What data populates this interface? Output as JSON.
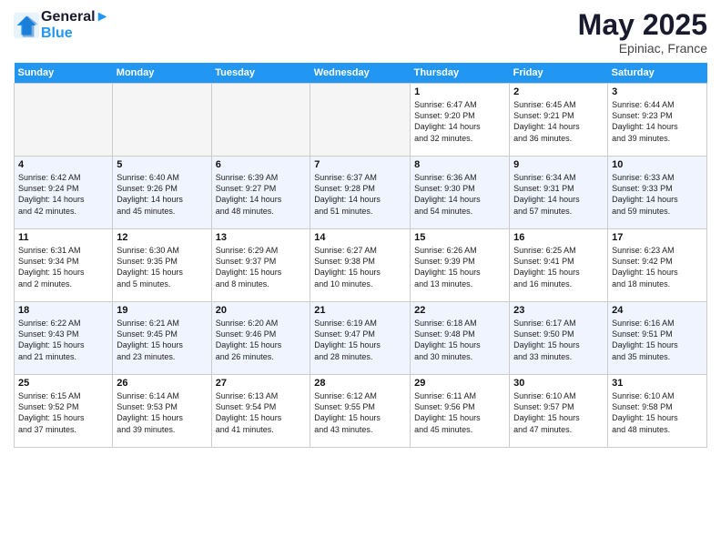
{
  "header": {
    "logo_line1": "General",
    "logo_line2": "Blue",
    "month": "May 2025",
    "location": "Epiniac, France"
  },
  "weekdays": [
    "Sunday",
    "Monday",
    "Tuesday",
    "Wednesday",
    "Thursday",
    "Friday",
    "Saturday"
  ],
  "weeks": [
    [
      {
        "day": "",
        "info": ""
      },
      {
        "day": "",
        "info": ""
      },
      {
        "day": "",
        "info": ""
      },
      {
        "day": "",
        "info": ""
      },
      {
        "day": "1",
        "info": "Sunrise: 6:47 AM\nSunset: 9:20 PM\nDaylight: 14 hours\nand 32 minutes."
      },
      {
        "day": "2",
        "info": "Sunrise: 6:45 AM\nSunset: 9:21 PM\nDaylight: 14 hours\nand 36 minutes."
      },
      {
        "day": "3",
        "info": "Sunrise: 6:44 AM\nSunset: 9:23 PM\nDaylight: 14 hours\nand 39 minutes."
      }
    ],
    [
      {
        "day": "4",
        "info": "Sunrise: 6:42 AM\nSunset: 9:24 PM\nDaylight: 14 hours\nand 42 minutes."
      },
      {
        "day": "5",
        "info": "Sunrise: 6:40 AM\nSunset: 9:26 PM\nDaylight: 14 hours\nand 45 minutes."
      },
      {
        "day": "6",
        "info": "Sunrise: 6:39 AM\nSunset: 9:27 PM\nDaylight: 14 hours\nand 48 minutes."
      },
      {
        "day": "7",
        "info": "Sunrise: 6:37 AM\nSunset: 9:28 PM\nDaylight: 14 hours\nand 51 minutes."
      },
      {
        "day": "8",
        "info": "Sunrise: 6:36 AM\nSunset: 9:30 PM\nDaylight: 14 hours\nand 54 minutes."
      },
      {
        "day": "9",
        "info": "Sunrise: 6:34 AM\nSunset: 9:31 PM\nDaylight: 14 hours\nand 57 minutes."
      },
      {
        "day": "10",
        "info": "Sunrise: 6:33 AM\nSunset: 9:33 PM\nDaylight: 14 hours\nand 59 minutes."
      }
    ],
    [
      {
        "day": "11",
        "info": "Sunrise: 6:31 AM\nSunset: 9:34 PM\nDaylight: 15 hours\nand 2 minutes."
      },
      {
        "day": "12",
        "info": "Sunrise: 6:30 AM\nSunset: 9:35 PM\nDaylight: 15 hours\nand 5 minutes."
      },
      {
        "day": "13",
        "info": "Sunrise: 6:29 AM\nSunset: 9:37 PM\nDaylight: 15 hours\nand 8 minutes."
      },
      {
        "day": "14",
        "info": "Sunrise: 6:27 AM\nSunset: 9:38 PM\nDaylight: 15 hours\nand 10 minutes."
      },
      {
        "day": "15",
        "info": "Sunrise: 6:26 AM\nSunset: 9:39 PM\nDaylight: 15 hours\nand 13 minutes."
      },
      {
        "day": "16",
        "info": "Sunrise: 6:25 AM\nSunset: 9:41 PM\nDaylight: 15 hours\nand 16 minutes."
      },
      {
        "day": "17",
        "info": "Sunrise: 6:23 AM\nSunset: 9:42 PM\nDaylight: 15 hours\nand 18 minutes."
      }
    ],
    [
      {
        "day": "18",
        "info": "Sunrise: 6:22 AM\nSunset: 9:43 PM\nDaylight: 15 hours\nand 21 minutes."
      },
      {
        "day": "19",
        "info": "Sunrise: 6:21 AM\nSunset: 9:45 PM\nDaylight: 15 hours\nand 23 minutes."
      },
      {
        "day": "20",
        "info": "Sunrise: 6:20 AM\nSunset: 9:46 PM\nDaylight: 15 hours\nand 26 minutes."
      },
      {
        "day": "21",
        "info": "Sunrise: 6:19 AM\nSunset: 9:47 PM\nDaylight: 15 hours\nand 28 minutes."
      },
      {
        "day": "22",
        "info": "Sunrise: 6:18 AM\nSunset: 9:48 PM\nDaylight: 15 hours\nand 30 minutes."
      },
      {
        "day": "23",
        "info": "Sunrise: 6:17 AM\nSunset: 9:50 PM\nDaylight: 15 hours\nand 33 minutes."
      },
      {
        "day": "24",
        "info": "Sunrise: 6:16 AM\nSunset: 9:51 PM\nDaylight: 15 hours\nand 35 minutes."
      }
    ],
    [
      {
        "day": "25",
        "info": "Sunrise: 6:15 AM\nSunset: 9:52 PM\nDaylight: 15 hours\nand 37 minutes."
      },
      {
        "day": "26",
        "info": "Sunrise: 6:14 AM\nSunset: 9:53 PM\nDaylight: 15 hours\nand 39 minutes."
      },
      {
        "day": "27",
        "info": "Sunrise: 6:13 AM\nSunset: 9:54 PM\nDaylight: 15 hours\nand 41 minutes."
      },
      {
        "day": "28",
        "info": "Sunrise: 6:12 AM\nSunset: 9:55 PM\nDaylight: 15 hours\nand 43 minutes."
      },
      {
        "day": "29",
        "info": "Sunrise: 6:11 AM\nSunset: 9:56 PM\nDaylight: 15 hours\nand 45 minutes."
      },
      {
        "day": "30",
        "info": "Sunrise: 6:10 AM\nSunset: 9:57 PM\nDaylight: 15 hours\nand 47 minutes."
      },
      {
        "day": "31",
        "info": "Sunrise: 6:10 AM\nSunset: 9:58 PM\nDaylight: 15 hours\nand 48 minutes."
      }
    ]
  ]
}
